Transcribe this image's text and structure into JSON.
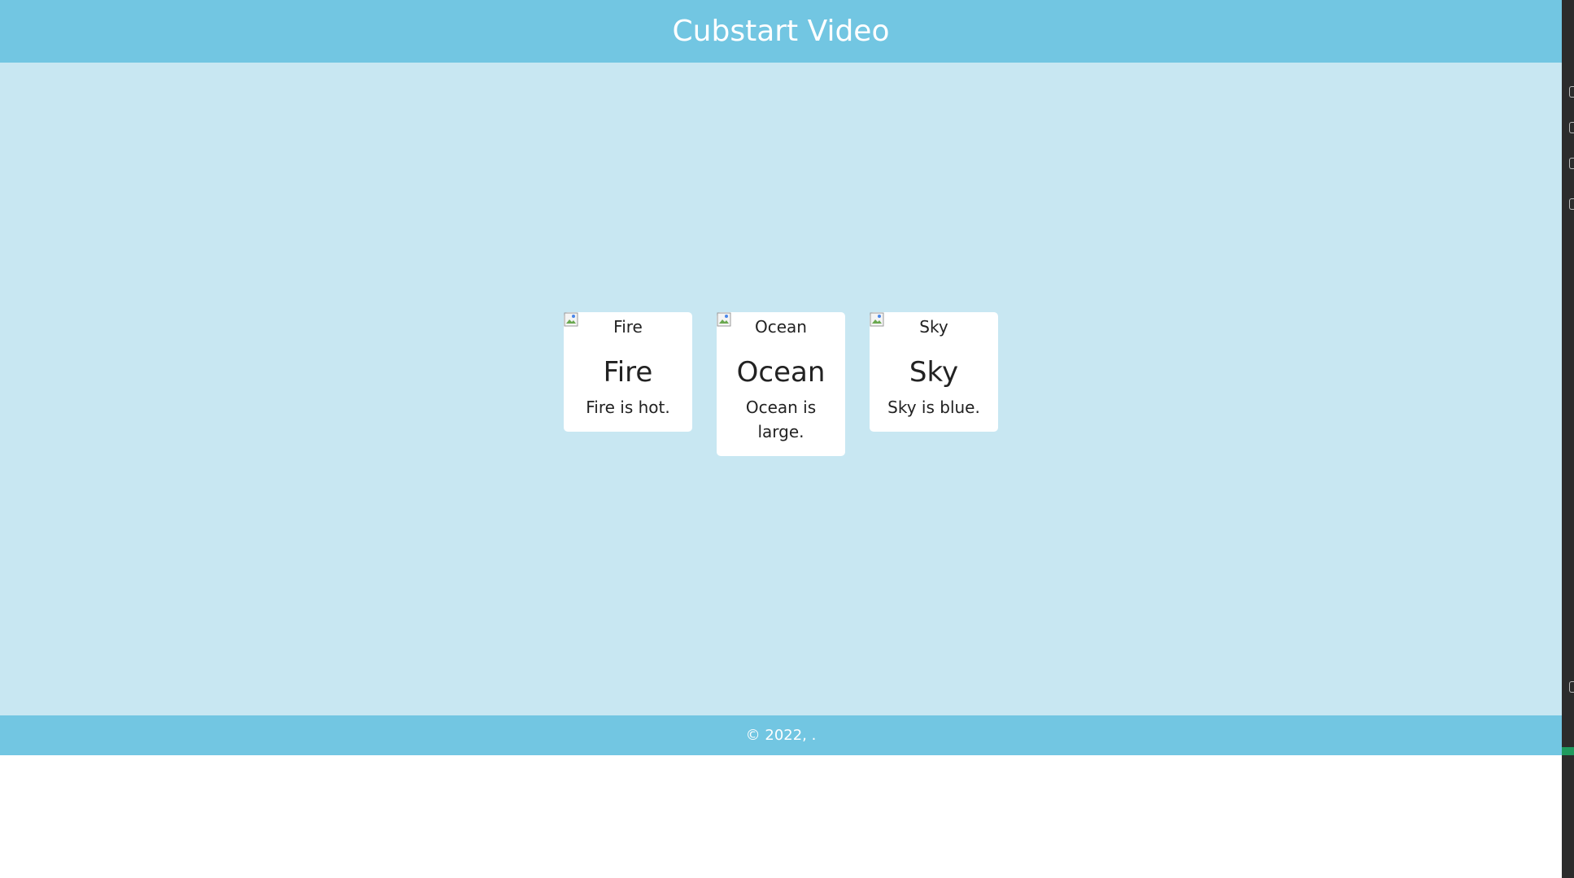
{
  "header": {
    "title": "Cubstart Video"
  },
  "cards": [
    {
      "image_alt": "Fire",
      "title": "Fire",
      "description": "Fire is hot."
    },
    {
      "image_alt": "Ocean",
      "title": "Ocean",
      "description": "Ocean is large."
    },
    {
      "image_alt": "Sky",
      "title": "Sky",
      "description": "Sky is blue."
    }
  ],
  "footer": {
    "text": "© 2022, ."
  },
  "colors": {
    "header_bg": "#72c6e2",
    "main_bg": "#c8e7f2",
    "card_bg": "#ffffff"
  },
  "icons": {
    "broken_image": "broken-image-icon"
  }
}
